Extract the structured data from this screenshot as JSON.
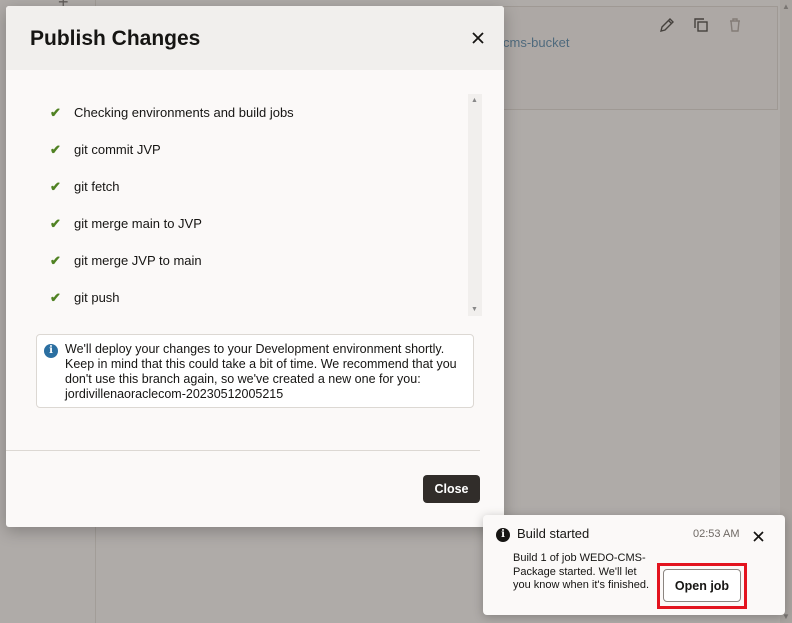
{
  "background": {
    "link_text": "cms-bucket",
    "toolbar_icons": [
      "pencil-icon",
      "copy-icon",
      "trash-icon"
    ]
  },
  "dialog": {
    "title": "Publish Changes",
    "steps": [
      {
        "label": "Checking environments and build jobs",
        "status": "done"
      },
      {
        "label": "git commit JVP",
        "status": "done"
      },
      {
        "label": "git fetch",
        "status": "done"
      },
      {
        "label": "git merge main to JVP",
        "status": "done"
      },
      {
        "label": "git merge JVP to main",
        "status": "done"
      },
      {
        "label": "git push",
        "status": "done"
      }
    ],
    "check_glyph": "✔",
    "info_message": "We'll deploy your changes to your Development environment shortly. Keep in mind that this could take a bit of time. We recommend that you don't use this branch again, so we've created a new one for you: jordivillenaoraclecom-20230512005215",
    "close_label": "Close"
  },
  "toast": {
    "title": "Build started",
    "time": "02:53 AM",
    "message": "Build 1 of job WEDO-CMS-Package started. We'll let you know when it's finished.",
    "action_label": "Open job"
  },
  "colors": {
    "check": "#508223",
    "primary_button": "#312d2a",
    "info_icon": "#2b6fa1",
    "highlight": "#e3141f"
  }
}
